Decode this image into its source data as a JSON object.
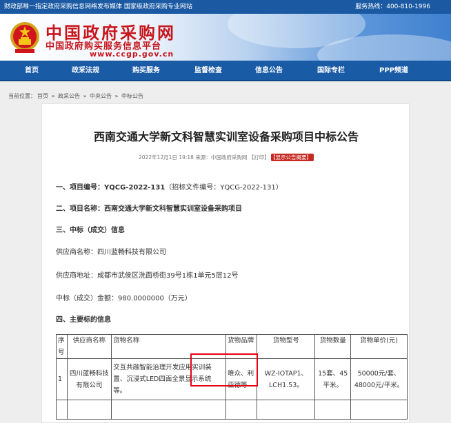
{
  "topbar": {
    "left": "财政部唯一指定政府采购信息网络发布媒体 国家级政府采购专业网站",
    "right": "服务热线：400-810-1996"
  },
  "header": {
    "site_name": "中国政府采购网",
    "site_subtitle": "中国政府购买服务信息平台",
    "site_url": "www.ccgp.gov.cn"
  },
  "nav": {
    "items": [
      "首页",
      "政采法规",
      "购买服务",
      "监督检查",
      "信息公告",
      "国际专栏",
      "PPP频道"
    ]
  },
  "breadcrumb": {
    "label": "当前位置：",
    "items": [
      "首页",
      "政采公告",
      "中央公告",
      "中标公告"
    ],
    "separator": "»"
  },
  "article": {
    "title": "西南交通大学新文科智慧实训室设备采购项目中标公告",
    "meta": "2022年12月1日 19:18 来源：中国政府采购网 【打印】",
    "meta_badge": "【显示公告概要】",
    "project_no_label": "一、项目编号：",
    "project_no": "YQCG-2022-131",
    "project_no_extra": "（招标文件编号：YQCG-2022-131）",
    "project_name_label": "二、项目名称：",
    "project_name": "西南交通大学新文科智慧实训室设备采购项目",
    "section3": "三、中标（成交）信息",
    "supplier_name": "供应商名称：四川蓝畅科技有限公司",
    "supplier_address": "供应商地址：成都市武侯区洗面桥街39号1栋1单元5层12号",
    "amount": "中标（成交）金额：980.0000000（万元）",
    "section4": "四、主要标的信息"
  },
  "table": {
    "headers": [
      "序号",
      "供应商名称",
      "货物名称",
      "货物品牌",
      "货物型号",
      "货物数量",
      "货物单价(元)"
    ],
    "rows": [
      [
        "1",
        "四川蓝畅科技有限公司",
        "交互共融智能治理开发应用实训装置、沉浸式LED四面全景显示系统等。",
        "唯众、利亚德等",
        "WZ-IOTAP1、LCH1.53。",
        "15套、45平米。",
        "50000元/套、48000元/平米。"
      ]
    ]
  },
  "colors": {
    "topbar": "#1b5aa3",
    "nav": "#1a5ba6",
    "brand_red": "#c7161d",
    "highlight_box": "#e60012"
  }
}
